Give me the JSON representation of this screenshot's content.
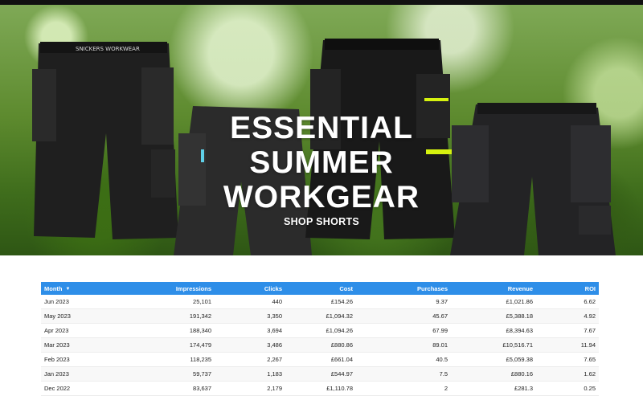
{
  "hero": {
    "brand_waistband": "SNICKERS WORKWEAR",
    "title_lines": [
      "ESSENTIAL",
      "SUMMER",
      "WORKGEAR"
    ],
    "cta_label": "SHOP SHORTS"
  },
  "colors": {
    "table_header": "#2e8ee8",
    "accent_hiviz": "#d6f20f"
  },
  "table": {
    "headers": {
      "month": "Month",
      "impressions": "Impressions",
      "clicks": "Clicks",
      "cost": "Cost",
      "purchases": "Purchases",
      "revenue": "Revenue",
      "roi": "ROI"
    },
    "sort_icon": "sort-desc-icon",
    "rows": [
      {
        "month": "Jun 2023",
        "impressions": "25,101",
        "clicks": "440",
        "cost": "£154.26",
        "purchases": "9.37",
        "revenue": "£1,021.86",
        "roi": "6.62"
      },
      {
        "month": "May 2023",
        "impressions": "191,342",
        "clicks": "3,350",
        "cost": "£1,094.32",
        "purchases": "45.67",
        "revenue": "£5,388.18",
        "roi": "4.92"
      },
      {
        "month": "Apr 2023",
        "impressions": "188,340",
        "clicks": "3,694",
        "cost": "£1,094.26",
        "purchases": "67.99",
        "revenue": "£8,394.63",
        "roi": "7.67"
      },
      {
        "month": "Mar 2023",
        "impressions": "174,479",
        "clicks": "3,486",
        "cost": "£880.86",
        "purchases": "89.01",
        "revenue": "£10,516.71",
        "roi": "11.94"
      },
      {
        "month": "Feb 2023",
        "impressions": "118,235",
        "clicks": "2,267",
        "cost": "£661.04",
        "purchases": "40.5",
        "revenue": "£5,059.38",
        "roi": "7.65"
      },
      {
        "month": "Jan 2023",
        "impressions": "59,737",
        "clicks": "1,183",
        "cost": "£544.97",
        "purchases": "7.5",
        "revenue": "£880.16",
        "roi": "1.62"
      },
      {
        "month": "Dec 2022",
        "impressions": "83,637",
        "clicks": "2,179",
        "cost": "£1,110.78",
        "purchases": "2",
        "revenue": "£281.3",
        "roi": "0.25"
      }
    ]
  }
}
